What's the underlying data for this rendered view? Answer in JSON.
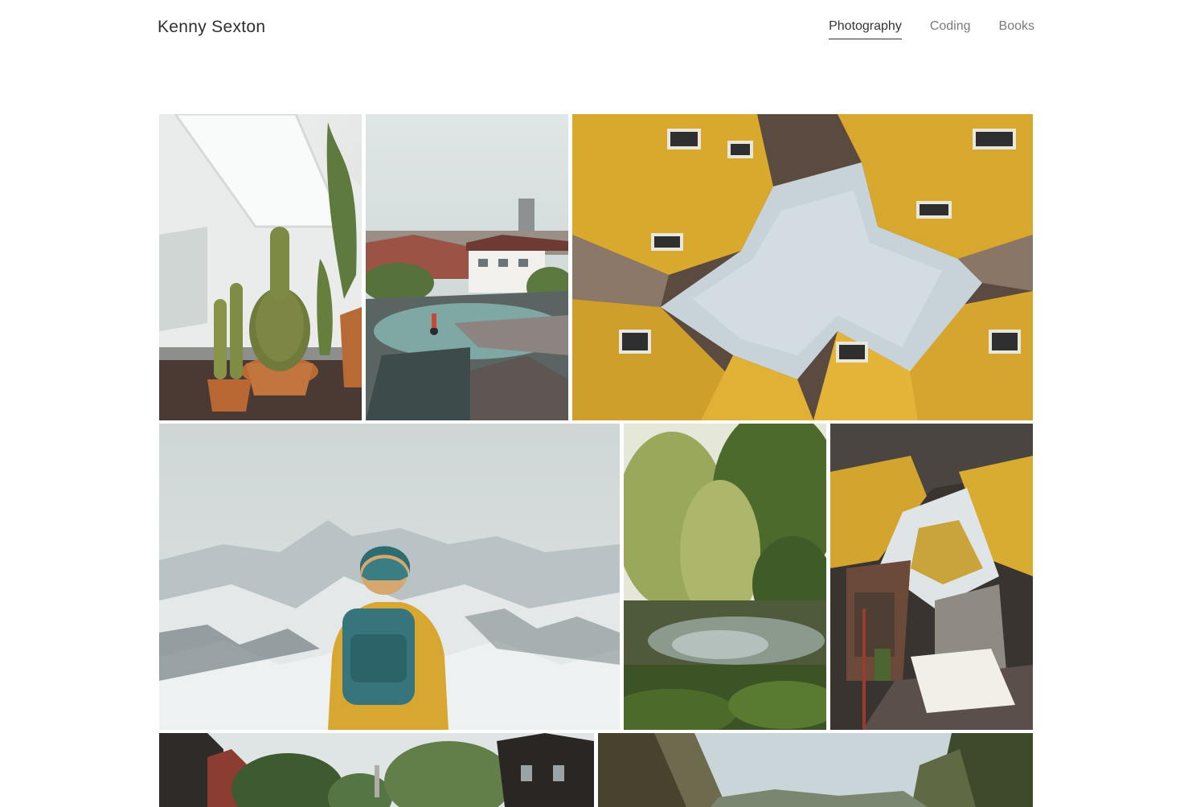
{
  "header": {
    "site_title": "Kenny Sexton",
    "nav": [
      {
        "label": "Photography",
        "active": true
      },
      {
        "label": "Coding",
        "active": false
      },
      {
        "label": "Books",
        "active": false
      }
    ]
  },
  "gallery": {
    "photos": [
      {
        "subject": "potted-cacti-on-windowsill"
      },
      {
        "subject": "cyclist-on-rooftop-plaza"
      },
      {
        "subject": "yellow-cube-houses-looking-up"
      },
      {
        "subject": "hiker-with-backpack-facing-snowy-mountains"
      },
      {
        "subject": "willow-trees-by-pond"
      },
      {
        "subject": "yellow-cube-houses-courtyard"
      },
      {
        "subject": "city-street-with-trees"
      },
      {
        "subject": "mountain-valley"
      }
    ]
  },
  "colors": {
    "background": "#ffffff",
    "nav_inactive": "#7b7b7b",
    "nav_active": "#333333",
    "cube_yellow": "#e2b533"
  }
}
